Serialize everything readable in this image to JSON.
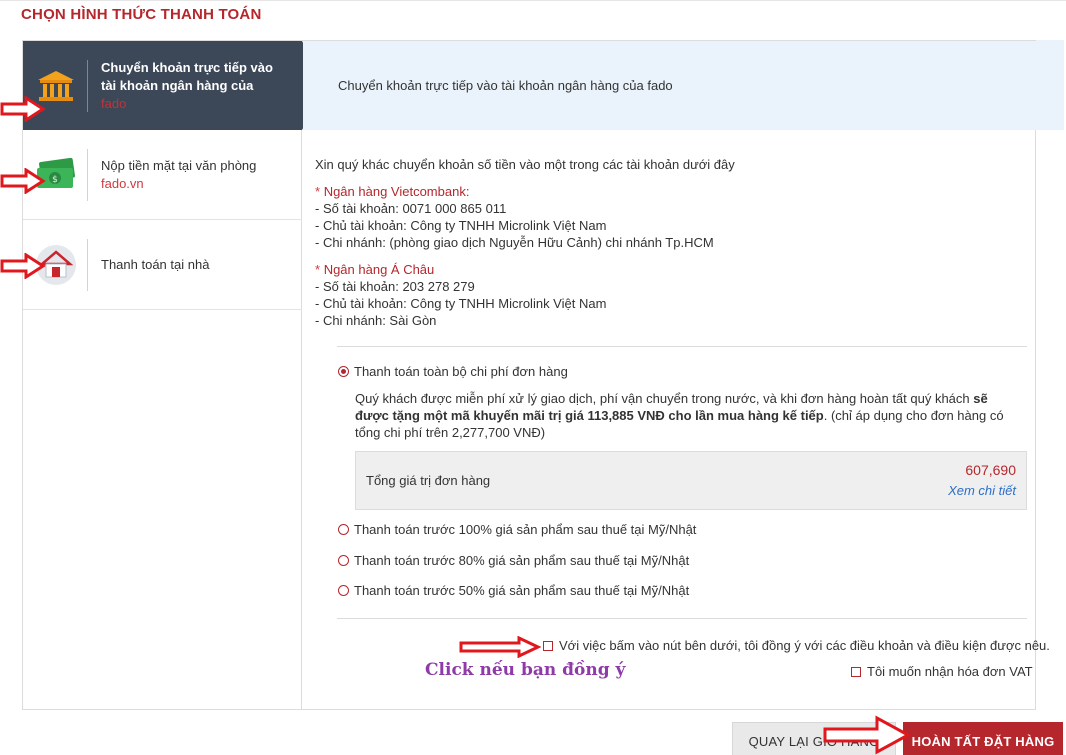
{
  "page": {
    "title": "CHỌN HÌNH THỨC THANH TOÁN"
  },
  "methods": [
    {
      "label_main": "Chuyển khoản trực tiếp vào tài khoản ngân hàng của ",
      "label_brand": "fado",
      "icon": "bank-icon",
      "active": true
    },
    {
      "label_main": "Nộp tiền mặt tại văn phòng ",
      "label_brand": "fado.vn",
      "icon": "cash-icon",
      "active": false
    },
    {
      "label_main": "Thanh toán tại nhà",
      "label_brand": "",
      "icon": "house-icon",
      "active": false
    }
  ],
  "content": {
    "header": "Chuyển khoản trực tiếp vào tài khoản ngân hàng của fado",
    "intro": "Xin quý khác chuyển khoản số tiền vào một trong các tài khoản dưới đây",
    "banks": [
      {
        "star": "*",
        "name": "Ngân hàng Vietcombank:",
        "account_number": "- Số tài khoản: 0071 000 865 011",
        "account_holder": "- Chủ tài khoản: Công ty TNHH Microlink Việt Nam",
        "branch": "- Chi nhánh: (phòng giao dịch Nguyễn Hữu Cảnh) chi nhánh Tp.HCM"
      },
      {
        "star": "*",
        "name": "Ngân hàng Á Châu",
        "account_number": "- Số tài khoản: 203 278 279",
        "account_holder": "- Chủ tài khoản: Công ty TNHH Microlink Việt Nam",
        "branch": "- Chi nhánh: Sài Gòn"
      }
    ]
  },
  "payment_options": [
    {
      "label": "Thanh toán toàn bộ chi phí đơn hàng",
      "checked": true
    },
    {
      "label": "Thanh toán trước 100% giá sản phẩm sau thuế tại Mỹ/Nhật",
      "checked": false
    },
    {
      "label": "Thanh toán trước 80% giá sản phẩm sau thuế tại Mỹ/Nhật",
      "checked": false
    },
    {
      "label": "Thanh toán trước 50% giá sản phẩm sau thuế tại Mỹ/Nhật",
      "checked": false
    }
  ],
  "promo": {
    "part1": "Quý khách được miễn phí xử lý giao dịch, phí vận chuyển trong nước, và khi đơn hàng hoàn tất quý khách ",
    "bold": "sẽ được tặng một mã khuyến mãi trị giá 113,885 VNĐ cho lần mua hàng kế tiếp",
    "part2": ". (chỉ áp dụng cho đơn hàng có tổng chi phí trên 2,277,700 VNĐ)"
  },
  "total": {
    "label": "Tổng giá trị đơn hàng",
    "value": "607,690",
    "details_link": "Xem chi tiết"
  },
  "agreements": {
    "terms": "Với việc bấm vào nút bên dưới, tôi đồng ý với các điều khoản và điều kiện được nêu.",
    "vat": "Tôi muốn nhận hóa đơn VAT"
  },
  "annotation": "Click nếu bạn đồng ý",
  "buttons": {
    "back": "QUAY LẠI GIỎ HÀNG",
    "finish": "HOÀN TẤT ĐẶT HÀNG"
  },
  "colors": {
    "brand_red": "#b5272d",
    "sidebar_active": "#3c4857",
    "header_bg": "#eaf3fb",
    "annotation_arrow": "#e0181e",
    "annotation_text": "#8e3aa8",
    "link_blue": "#2a6ec9"
  }
}
